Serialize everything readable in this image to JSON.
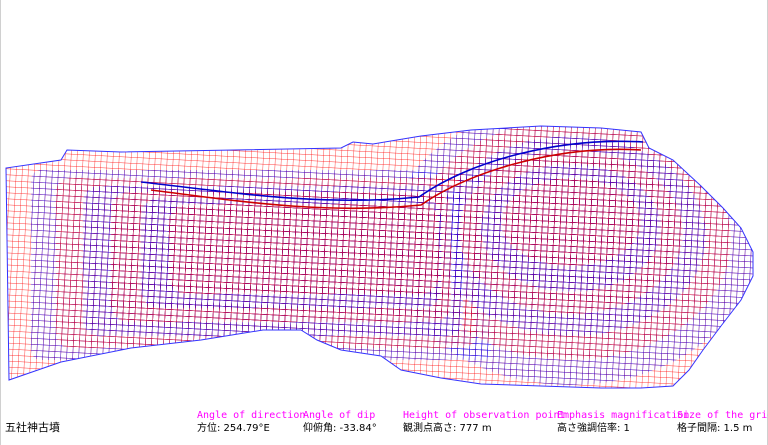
{
  "site": {
    "name": "五社神古墳"
  },
  "parameters": [
    {
      "label": "Angle of direction",
      "value": "方位:  254.79°E"
    },
    {
      "label": "Angle of dip",
      "value": "仰俯角: -33.84°"
    },
    {
      "label": "Height of observation point",
      "value": "観測点高さ:  777 m"
    },
    {
      "label": "Emphasis magnification",
      "value": "高さ強調倍率: 1"
    },
    {
      "label": "Size of the grid",
      "value": "格子間隔: 1.5 m"
    }
  ],
  "colors": {
    "label": "#ff00ff",
    "mesh_blue": "#0000ff",
    "mesh_red": "#ff0000",
    "background": "#ffffff"
  },
  "mesh": {
    "style": "wireframe-grid",
    "band_colors": [
      "red",
      "blue"
    ]
  }
}
